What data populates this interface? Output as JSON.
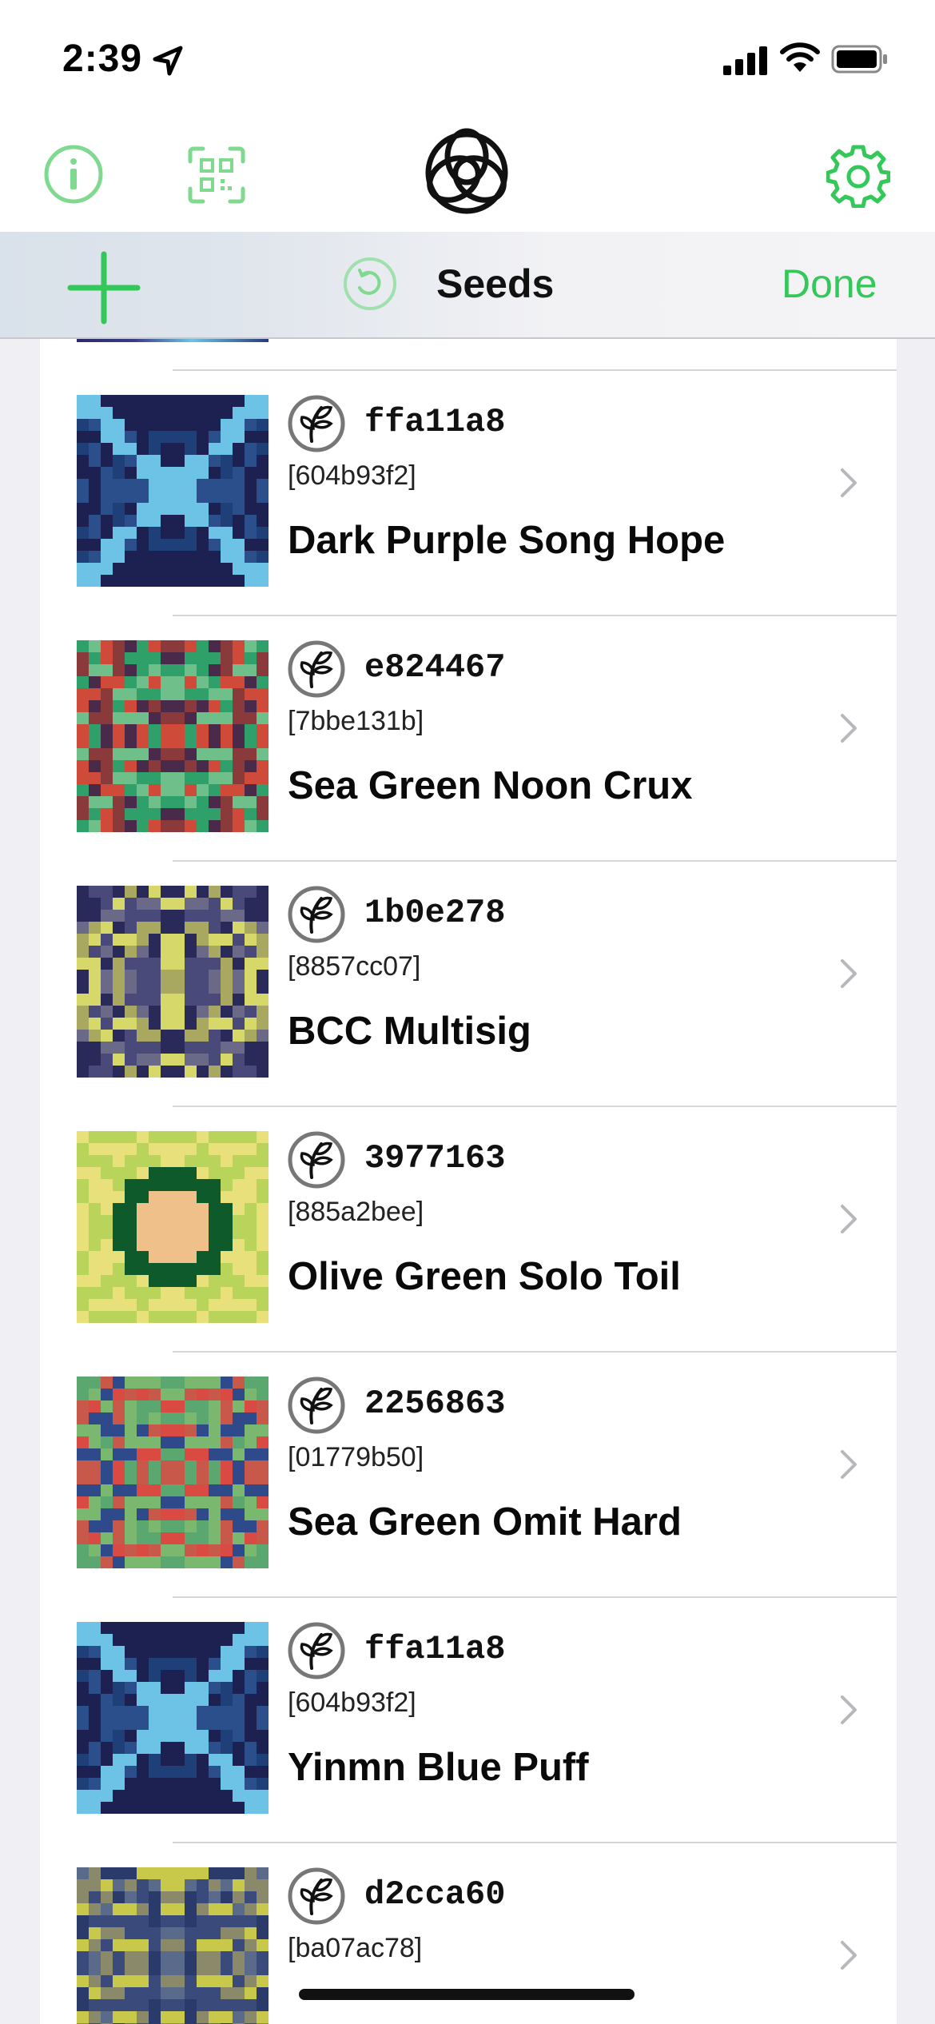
{
  "status_bar": {
    "time": "2:39"
  },
  "nav": {
    "title": "Seeds",
    "done_label": "Done"
  },
  "colors": {
    "accent": "#34c759",
    "accent_light": "#7fd98f"
  },
  "seeds": [
    {
      "id": "ffa11a8",
      "fingerprint": "[604b93f2]",
      "name": "Dark Purple Song Hope",
      "palette": [
        "#1c2152",
        "#2a4f8a",
        "#1e3f78",
        "#6cc3e6",
        "#3b6fb0"
      ],
      "pattern": "x"
    },
    {
      "id": "e824467",
      "fingerprint": "[7bbe131b]",
      "name": "Sea Green Noon Crux",
      "palette": [
        "#2fa06a",
        "#d04a3a",
        "#4a2a4a",
        "#6fbf8a",
        "#8a3a3a"
      ],
      "pattern": "h"
    },
    {
      "id": "1b0e278",
      "fingerprint": "[8857cc07]",
      "name": "BCC Multisig",
      "palette": [
        "#a8a860",
        "#d6d86a",
        "#4a4a7a",
        "#6a6a88",
        "#2a2a5a"
      ],
      "pattern": "blob"
    },
    {
      "id": "3977163",
      "fingerprint": "[885a2bee]",
      "name": "Olive Green Solo Toil",
      "palette": [
        "#b8d45a",
        "#2e8a3a",
        "#e8e07a",
        "#0f5a2a",
        "#f0c08a"
      ],
      "pattern": "ring"
    },
    {
      "id": "2256863",
      "fingerprint": "[01779b50]",
      "name": "Sea Green Omit Hard",
      "palette": [
        "#d84a42",
        "#5aa870",
        "#2e4a8a",
        "#7ab870",
        "#c8584a"
      ],
      "pattern": "v"
    },
    {
      "id": "ffa11a8",
      "fingerprint": "[604b93f2]",
      "name": "Yinmn Blue Puff",
      "palette": [
        "#1c2152",
        "#2a4f8a",
        "#1e3f78",
        "#6cc3e6",
        "#3b6fb0"
      ],
      "pattern": "x"
    },
    {
      "id": "d2cca60",
      "fingerprint": "[ba07ac78]",
      "name": "",
      "palette": [
        "#3a4a7a",
        "#c8c84a",
        "#5a6a8a",
        "#2a3a6a",
        "#8a8a6a"
      ],
      "pattern": "h"
    }
  ]
}
